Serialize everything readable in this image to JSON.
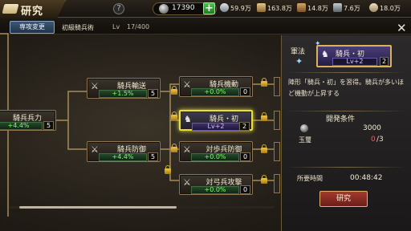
{
  "header": {
    "title": "研究",
    "help": "?",
    "gems": "17390",
    "add": "+",
    "resources": [
      {
        "name": "resource-1",
        "value": "59.9万",
        "color": "#bfc7cf"
      },
      {
        "name": "resource-2",
        "value": "163.8万",
        "color": "#c9a467"
      },
      {
        "name": "resource-3",
        "value": "14.8万",
        "color": "#b88a52"
      },
      {
        "name": "resource-4",
        "value": "7.6万",
        "color": "#9aa0a6"
      },
      {
        "name": "resource-5",
        "value": "18.0万",
        "color": "#d8c6a0"
      }
    ]
  },
  "subbar": {
    "change_button": "専攻変更",
    "tree_name": "初級騎兵術",
    "lv_label": "Lv",
    "lv_value": "17/400"
  },
  "nodes": {
    "kihei_heiryoku": {
      "name": "騎兵兵力",
      "bonus": "+4.4%",
      "level": "5"
    },
    "kihei_yuso": {
      "name": "騎兵輸送",
      "bonus": "+1.5%",
      "level": "5"
    },
    "kihei_bogyo": {
      "name": "騎兵防御",
      "bonus": "+4.4%",
      "level": "5"
    },
    "kihei_kido": {
      "name": "騎兵機動",
      "bonus": "+0.0%",
      "level": "0"
    },
    "kihei_sho": {
      "name": "騎兵・初",
      "bonus": "Lv+2",
      "level": "2"
    },
    "taiho_bogyo": {
      "name": "対歩兵防御",
      "bonus": "+0.0%",
      "level": "0"
    },
    "taikyu_kogeki": {
      "name": "対弓兵攻撃",
      "bonus": "+0.0%",
      "level": "0"
    }
  },
  "panel": {
    "close": "✕",
    "tactic_label": "軍法",
    "tactic_name": "騎兵・初",
    "tactic_level": "Lv+2",
    "tactic_count": "2",
    "description": "陣形「騎兵・初」を習得。騎兵が多いほど機動が上昇する",
    "conditions_title": "開発条件",
    "cost_value": "3000",
    "item_name": "玉璽",
    "item_have": "0",
    "item_need": "/3",
    "time_label": "所要時間",
    "time_value": "00:48:42",
    "research_button": "研究"
  },
  "colors": {
    "selected_border": "#e9df3c",
    "bonus_green": "#7bff6a",
    "lacking_red": "#ff5a5a",
    "accent_gold": "#d9b25a"
  }
}
